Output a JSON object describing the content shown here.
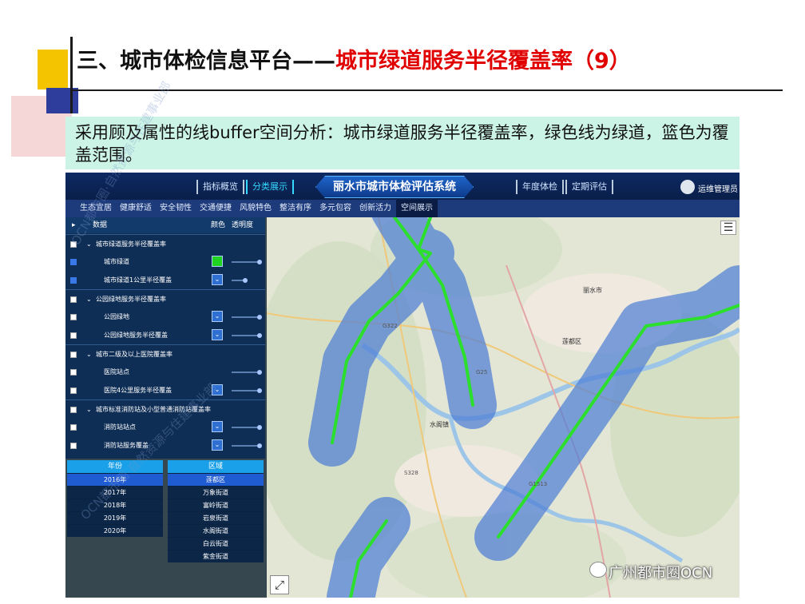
{
  "slide": {
    "title_prefix": "三、城市体检信息平台——",
    "title_highlight": "城市绿道服务半径覆盖率（9）",
    "subtitle": "采用顾及属性的线buffer空间分析：城市绿道服务半径覆盖率，绿色线为绿道，篮色为覆盖范围。"
  },
  "app": {
    "title": "丽水市城市体检评估系统",
    "header_buttons": [
      "指标概览",
      "分类展示",
      "年度体检",
      "定期评估"
    ],
    "active_header_button": "分类展示",
    "user": "运维管理员",
    "nav": [
      "生态宜居",
      "健康舒适",
      "安全韧性",
      "交通便捷",
      "风貌特色",
      "整洁有序",
      "多元包容",
      "创新活力",
      "空间展示"
    ],
    "active_nav": "空间展示"
  },
  "layer_panel": {
    "headers": {
      "data": "数据",
      "color": "颜色",
      "opacity": "透明度"
    },
    "rows": [
      {
        "label": "城市绿道服务半径覆盖率",
        "type": "group",
        "checked": false
      },
      {
        "label": "城市绿道",
        "type": "layer",
        "checked": true,
        "swatch": "green",
        "opacity": 1.0
      },
      {
        "label": "城市绿道1公里半径覆盖",
        "type": "layer",
        "checked": true,
        "swatch": "blue",
        "opacity": 0.5
      },
      {
        "label": "公园绿地服务半径覆盖率",
        "type": "group",
        "checked": false
      },
      {
        "label": "公园绿地",
        "type": "layer",
        "checked": false,
        "swatch": "blue",
        "opacity": 1.0
      },
      {
        "label": "公园绿地服务半径覆盖",
        "type": "layer",
        "checked": false,
        "swatch": "blue",
        "opacity": 1.0
      },
      {
        "label": "城市二级及以上医院覆盖率",
        "type": "group",
        "checked": false
      },
      {
        "label": "医院站点",
        "type": "layer",
        "checked": false,
        "swatch": "blue",
        "opacity": 1.0
      },
      {
        "label": "医院4公里服务半径覆盖",
        "type": "layer",
        "checked": false,
        "swatch": "blue",
        "opacity": 1.0
      },
      {
        "label": "城市标准消防站及小型普通消防站覆盖率",
        "type": "group",
        "checked": false
      },
      {
        "label": "消防站站点",
        "type": "layer",
        "checked": false,
        "swatch": "blue",
        "opacity": 1.0
      },
      {
        "label": "消防站服务覆盖",
        "type": "layer",
        "checked": false,
        "swatch": "blue",
        "opacity": 1.0
      }
    ]
  },
  "year_table": {
    "header": "年份",
    "items": [
      "2016年",
      "2017年",
      "2018年",
      "2019年",
      "2020年"
    ],
    "selected": "2016年"
  },
  "district_table": {
    "header": "区域",
    "items": [
      "莲都区",
      "万象街道",
      "富岭街道",
      "岩泉街道",
      "水阁街道",
      "白云街道",
      "紫金街道"
    ],
    "selected": "莲都区"
  },
  "map": {
    "labels": [
      "丽水市",
      "莲都区",
      "水阁镇",
      "G322",
      "G25",
      "S328",
      "G1513"
    ],
    "greenway_color": "#2cdf2c",
    "buffer_color": "#4f7fd6"
  },
  "watermarks": [
    "OCN都市圈·自然资源与住建事业部",
    "OCN都市圈·自然资源与住建事业部"
  ],
  "wechat_account": "广州都市圈OCN"
}
